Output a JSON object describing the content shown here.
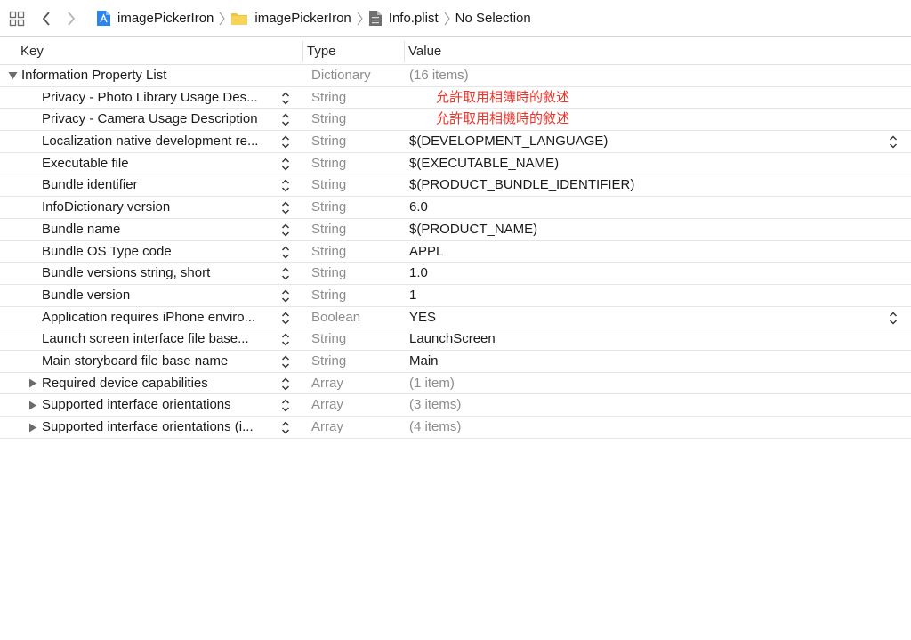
{
  "jumpbar": {
    "crumbs": [
      {
        "label": "imagePickerIron",
        "icon": "xcode-project-icon"
      },
      {
        "label": "imagePickerIron",
        "icon": "folder-icon"
      },
      {
        "label": "Info.plist",
        "icon": "plist-file-icon"
      },
      {
        "label": "No Selection",
        "icon": ""
      }
    ]
  },
  "columns": {
    "key": "Key",
    "type": "Type",
    "value": "Value"
  },
  "rows": [
    {
      "key": "Information Property List",
      "type": "Dictionary",
      "value": "(16 items)",
      "expander": "expanded",
      "level": 0,
      "value_style": "muted",
      "stepper": false,
      "value_stepper": false
    },
    {
      "key": "Privacy - Photo Library Usage Des...",
      "type": "String",
      "value": "允許取用相簿時的敘述",
      "expander": "none",
      "level": 1,
      "value_style": "red",
      "stepper": true,
      "value_stepper": false
    },
    {
      "key": "Privacy - Camera Usage Description",
      "type": "String",
      "value": "允許取用相機時的敘述",
      "expander": "none",
      "level": 1,
      "value_style": "red",
      "stepper": true,
      "value_stepper": false
    },
    {
      "key": "Localization native development re...",
      "type": "String",
      "value": "$(DEVELOPMENT_LANGUAGE)",
      "expander": "none",
      "level": 1,
      "value_style": "normal",
      "stepper": true,
      "value_stepper": true
    },
    {
      "key": "Executable file",
      "type": "String",
      "value": "$(EXECUTABLE_NAME)",
      "expander": "none",
      "level": 1,
      "value_style": "normal",
      "stepper": true,
      "value_stepper": false
    },
    {
      "key": "Bundle identifier",
      "type": "String",
      "value": "$(PRODUCT_BUNDLE_IDENTIFIER)",
      "expander": "none",
      "level": 1,
      "value_style": "normal",
      "stepper": true,
      "value_stepper": false
    },
    {
      "key": "InfoDictionary version",
      "type": "String",
      "value": "6.0",
      "expander": "none",
      "level": 1,
      "value_style": "normal",
      "stepper": true,
      "value_stepper": false
    },
    {
      "key": "Bundle name",
      "type": "String",
      "value": "$(PRODUCT_NAME)",
      "expander": "none",
      "level": 1,
      "value_style": "normal",
      "stepper": true,
      "value_stepper": false
    },
    {
      "key": "Bundle OS Type code",
      "type": "String",
      "value": "APPL",
      "expander": "none",
      "level": 1,
      "value_style": "normal",
      "stepper": true,
      "value_stepper": false
    },
    {
      "key": "Bundle versions string, short",
      "type": "String",
      "value": "1.0",
      "expander": "none",
      "level": 1,
      "value_style": "normal",
      "stepper": true,
      "value_stepper": false
    },
    {
      "key": "Bundle version",
      "type": "String",
      "value": "1",
      "expander": "none",
      "level": 1,
      "value_style": "normal",
      "stepper": true,
      "value_stepper": false
    },
    {
      "key": "Application requires iPhone enviro...",
      "type": "Boolean",
      "value": "YES",
      "expander": "none",
      "level": 1,
      "value_style": "normal",
      "stepper": true,
      "value_stepper": true
    },
    {
      "key": "Launch screen interface file base...",
      "type": "String",
      "value": "LaunchScreen",
      "expander": "none",
      "level": 1,
      "value_style": "normal",
      "stepper": true,
      "value_stepper": false
    },
    {
      "key": "Main storyboard file base name",
      "type": "String",
      "value": "Main",
      "expander": "none",
      "level": 1,
      "value_style": "normal",
      "stepper": true,
      "value_stepper": false
    },
    {
      "key": "Required device capabilities",
      "type": "Array",
      "value": "(1 item)",
      "expander": "collapsed",
      "level": 1,
      "value_style": "muted",
      "stepper": true,
      "value_stepper": false
    },
    {
      "key": "Supported interface orientations",
      "type": "Array",
      "value": "(3 items)",
      "expander": "collapsed",
      "level": 1,
      "value_style": "muted",
      "stepper": true,
      "value_stepper": false
    },
    {
      "key": "Supported interface orientations (i...",
      "type": "Array",
      "value": "(4 items)",
      "expander": "collapsed",
      "level": 1,
      "value_style": "muted",
      "stepper": true,
      "value_stepper": false
    }
  ],
  "colors": {
    "accent_red": "#e8342b",
    "muted_text": "#8c8c8c",
    "folder_yellow": "#f5c33b",
    "project_blue": "#1f7ae8"
  }
}
